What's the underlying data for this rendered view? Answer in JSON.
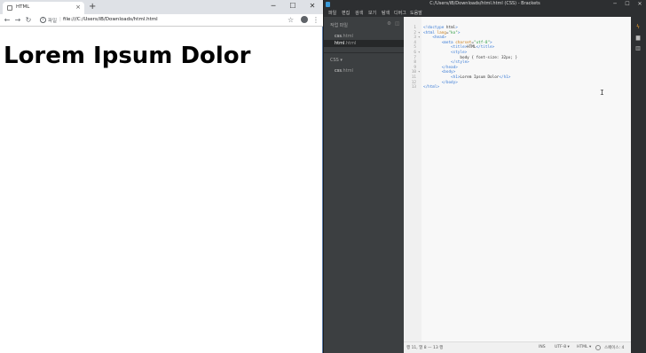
{
  "chrome": {
    "tab": {
      "title": "HTML",
      "close": "×"
    },
    "new_tab": "+",
    "window_controls": {
      "minimize": "─",
      "maximize": "☐",
      "close": "✕"
    },
    "nav": {
      "back": "←",
      "forward": "→",
      "reload": "↻"
    },
    "omnibox": {
      "scheme": "파일",
      "separator": "|",
      "url": "file:///C:/Users/iB/Downloads/html.html"
    },
    "star": "☆",
    "menu": "⋮",
    "page": {
      "heading": "Lorem Ipsum Dolor"
    }
  },
  "brackets": {
    "title": "C:/Users/iB/Downloads/html.html (CSS) - Brackets",
    "window_controls": {
      "minimize": "─",
      "maximize": "☐",
      "close": "✕"
    },
    "menu": [
      "파일",
      "편집",
      "검색",
      "보기",
      "탐색",
      "디버그",
      "도움말"
    ],
    "sidebar": {
      "working_files_header": "작업 파일",
      "working_files": [
        {
          "name": "css",
          "ext": ".html",
          "active": false
        },
        {
          "name": "html",
          "ext": ".html",
          "active": true
        }
      ],
      "project_header": "CSS ▾",
      "project_files": [
        {
          "name": "css",
          "ext": ".html"
        }
      ]
    },
    "editor": {
      "lines": [
        {
          "num": "1",
          "fold": "",
          "text": "<!doctype html>"
        },
        {
          "num": "2",
          "fold": "▾",
          "text": "<html lang=\"ko\">"
        },
        {
          "num": "3",
          "fold": "▾",
          "text": "    <head>"
        },
        {
          "num": "4",
          "fold": "",
          "text": "        <meta charset=\"utf-8\">"
        },
        {
          "num": "5",
          "fold": "",
          "text": "            <title>HTML</title>"
        },
        {
          "num": "6",
          "fold": "▾",
          "text": "            <style>"
        },
        {
          "num": "7",
          "fold": "",
          "text": "                body { font-size: 32px; }"
        },
        {
          "num": "8",
          "fold": "",
          "text": "            </style>"
        },
        {
          "num": "9",
          "fold": "",
          "text": "        </head>"
        },
        {
          "num": "10",
          "fold": "▾",
          "text": "        <body>"
        },
        {
          "num": "11",
          "fold": "",
          "text": "            <h1>Lorem Ipsum Dolor</h1>"
        },
        {
          "num": "12",
          "fold": "",
          "text": "        </body>"
        },
        {
          "num": "13",
          "fold": "",
          "text": "</html>"
        }
      ],
      "caret": "I"
    },
    "status": {
      "position": "행 11, 열 8 — 13 행",
      "ins": "INS",
      "encoding": "UTF-8 ▾",
      "language": "HTML ▾",
      "spaces": "스페이스: 4"
    },
    "colors": {
      "tag": "#3a7bd5",
      "attr": "#c67a14",
      "string": "#2e9c41",
      "text": "#333333"
    }
  }
}
